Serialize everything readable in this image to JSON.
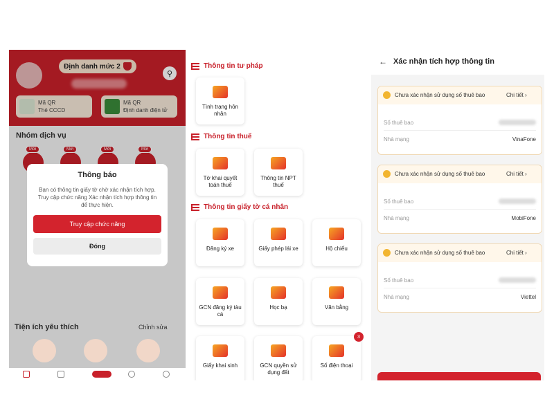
{
  "colors": {
    "brand_red": "#c8202a",
    "accent_orange": "#f6a623",
    "warning_yellow": "#f2b530"
  },
  "panel1": {
    "id_level_label": "Định danh mức 2",
    "qr_cards": [
      {
        "line1": "Mã QR",
        "line2": "Thẻ CCCD"
      },
      {
        "line1": "Mã QR",
        "line2": "Định danh điện tử"
      }
    ],
    "service_group_title": "Nhóm dịch vụ",
    "service_badges": [
      "Mới",
      "Mới",
      "Mới",
      "Mới"
    ],
    "dialog": {
      "title": "Thông báo",
      "message": "Bạn có thông tin giấy tờ chờ xác nhận tích hợp. Truy cập chức năng Xác nhận tích hợp thông tin để thực hiện.",
      "primary_button": "Truy cập chức năng",
      "secondary_button": "Đóng"
    },
    "favorites_title": "Tiện ích yêu thích",
    "edit_label": "Chỉnh sửa"
  },
  "panel2": {
    "categories": [
      {
        "title": "Thông tin tư pháp",
        "tiles": [
          {
            "label": "Tình trạng hôn nhân"
          }
        ]
      },
      {
        "title": "Thông tin thuế",
        "tiles": [
          {
            "label": "Tờ khai quyết toán thuế"
          },
          {
            "label": "Thông tin NPT thuế"
          }
        ]
      },
      {
        "title": "Thông tin giấy tờ cá nhân",
        "tiles": [
          {
            "label": "Đăng ký xe"
          },
          {
            "label": "Giấy phép lái xe"
          },
          {
            "label": "Hộ chiếu"
          },
          {
            "label": "GCN đăng ký tàu cá"
          },
          {
            "label": "Học bạ"
          },
          {
            "label": "Văn bằng"
          },
          {
            "label": "Giấy khai sinh"
          },
          {
            "label": "GCN quyền sử dụng đất"
          },
          {
            "label": "Số điện thoại",
            "badge": "3"
          }
        ]
      }
    ]
  },
  "panel3": {
    "title": "Xác nhận tích hợp thông tin",
    "cards": [
      {
        "status": "Chưa xác nhận sử dụng số thuê bao",
        "detail": "Chi tiết",
        "number_label": "Số thuê bao",
        "carrier_label": "Nhà mạng",
        "carrier": "VinaFone"
      },
      {
        "status": "Chưa xác nhận sử dụng số thuê bao",
        "detail": "Chi tiết",
        "number_label": "Số thuê bao",
        "carrier_label": "Nhà mạng",
        "carrier": "MobiFone"
      },
      {
        "status": "Chưa xác nhận sử dụng số thuê bao",
        "detail": "Chi tiết",
        "number_label": "Số thuê bao",
        "carrier_label": "Nhà mạng",
        "carrier": "Viettel"
      }
    ]
  }
}
